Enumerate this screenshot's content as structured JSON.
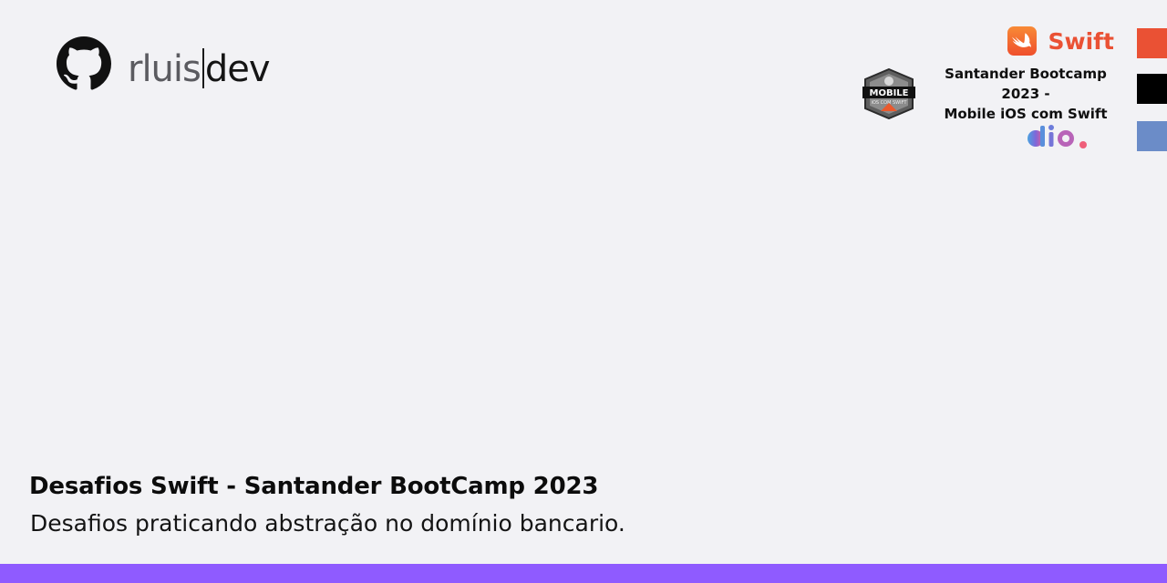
{
  "brand": {
    "username_part1": "rluis",
    "username_part2": "dev",
    "icon": "github-icon"
  },
  "swift_badge": {
    "label": "Swift",
    "icon": "swift-bird-icon",
    "color": "#ea5134"
  },
  "bootcamp": {
    "badge_text": "MOBILE",
    "badge_subtext": "iOS COM SWIFT",
    "title_line1": "Santander Bootcamp 2023 -",
    "title_line2": "Mobile iOS com Swift",
    "icon": "mobile-ios-badge"
  },
  "dio": {
    "logo_text": "dio.",
    "icon": "dio-logo"
  },
  "accent_bars": {
    "colors": [
      "#ea5134",
      "#000000",
      "#6b8cc8"
    ]
  },
  "repo": {
    "title": "Desafios Swift - Santander BootCamp 2023",
    "description": "Desafios praticando abstração no domínio bancario."
  },
  "theme": {
    "background": "#f2f2f5",
    "footer": "#8f5bff"
  }
}
